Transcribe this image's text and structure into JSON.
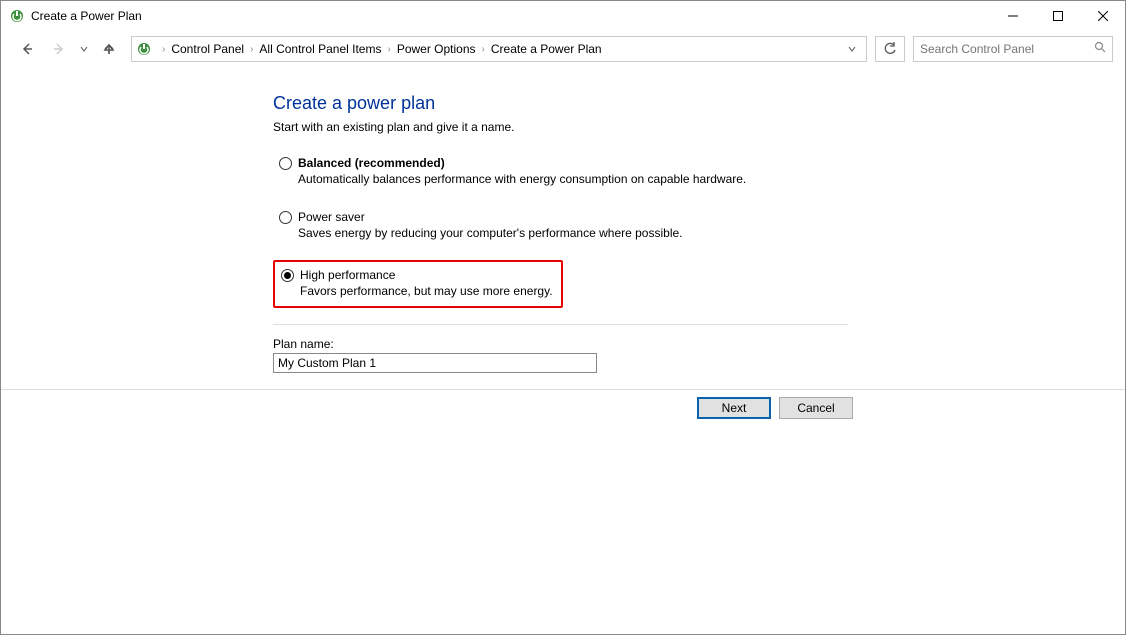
{
  "window": {
    "title": "Create a Power Plan"
  },
  "breadcrumb": {
    "items": [
      "Control Panel",
      "All Control Panel Items",
      "Power Options",
      "Create a Power Plan"
    ]
  },
  "search": {
    "placeholder": "Search Control Panel"
  },
  "page": {
    "title": "Create a power plan",
    "subtitle": "Start with an existing plan and give it a name."
  },
  "plans": [
    {
      "label": "Balanced (recommended)",
      "desc": "Automatically balances performance with energy consumption on capable hardware.",
      "bold": true,
      "selected": false,
      "highlighted": false
    },
    {
      "label": "Power saver",
      "desc": "Saves energy by reducing your computer's performance where possible.",
      "bold": false,
      "selected": false,
      "highlighted": false
    },
    {
      "label": "High performance",
      "desc": "Favors performance, but may use more energy.",
      "bold": false,
      "selected": true,
      "highlighted": true
    }
  ],
  "planName": {
    "label": "Plan name:",
    "value": "My Custom Plan 1"
  },
  "buttons": {
    "next": "Next",
    "cancel": "Cancel"
  }
}
